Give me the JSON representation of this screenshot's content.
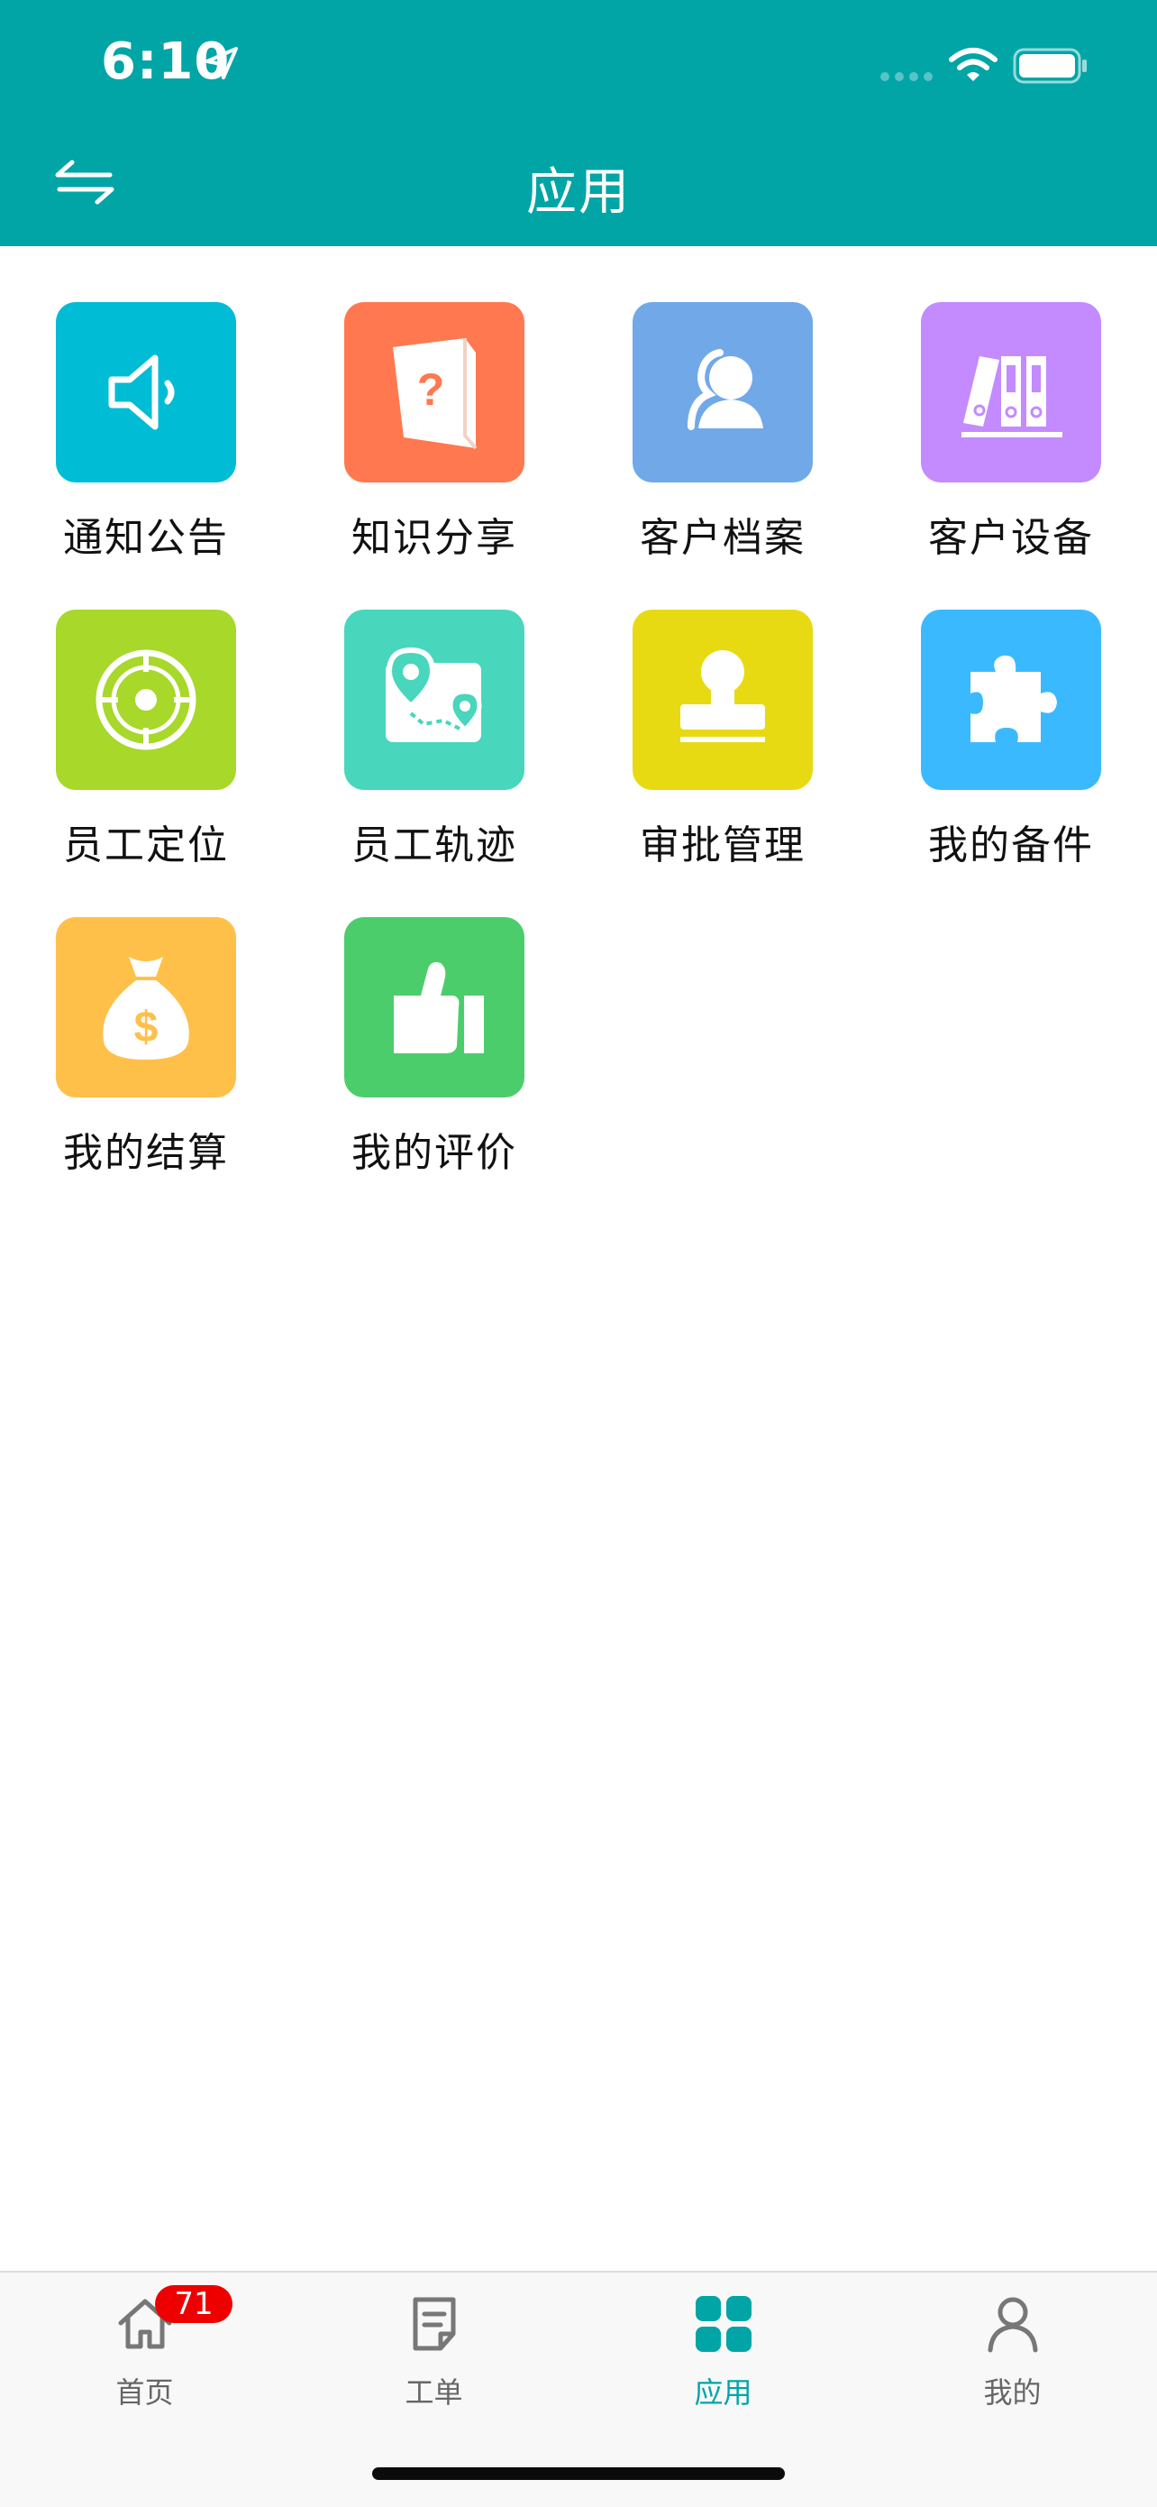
{
  "status_bar": {
    "time": "6:10"
  },
  "header": {
    "title": "应用"
  },
  "apps": [
    {
      "label": "通知公告",
      "color": "#00BCD4",
      "icon": "megaphone-icon"
    },
    {
      "label": "知识分享",
      "color": "#FF784F",
      "icon": "question-book-icon"
    },
    {
      "label": "客户档案",
      "color": "#71A8E8",
      "icon": "customers-icon"
    },
    {
      "label": "客户设备",
      "color": "#C38BFF",
      "icon": "binders-icon"
    },
    {
      "label": "员工定位",
      "color": "#A7D82A",
      "icon": "target-icon"
    },
    {
      "label": "员工轨迹",
      "color": "#48D6BC",
      "icon": "map-track-icon"
    },
    {
      "label": "审批管理",
      "color": "#E8DA12",
      "icon": "stamp-icon"
    },
    {
      "label": "我的备件",
      "color": "#3BB9FF",
      "icon": "puzzle-icon"
    },
    {
      "label": "我的结算",
      "color": "#FFC04A",
      "icon": "money-bag-icon"
    },
    {
      "label": "我的评价",
      "color": "#4CCD6C",
      "icon": "thumbs-up-icon"
    }
  ],
  "tabs": [
    {
      "label": "首页",
      "icon": "home-icon",
      "badge": "71"
    },
    {
      "label": "工单",
      "icon": "work-order-icon"
    },
    {
      "label": "应用",
      "icon": "apps-grid-icon",
      "active": true
    },
    {
      "label": "我的",
      "icon": "profile-icon"
    }
  ],
  "colors": {
    "primary": "#01A5A6",
    "badge": "#EE0000"
  }
}
